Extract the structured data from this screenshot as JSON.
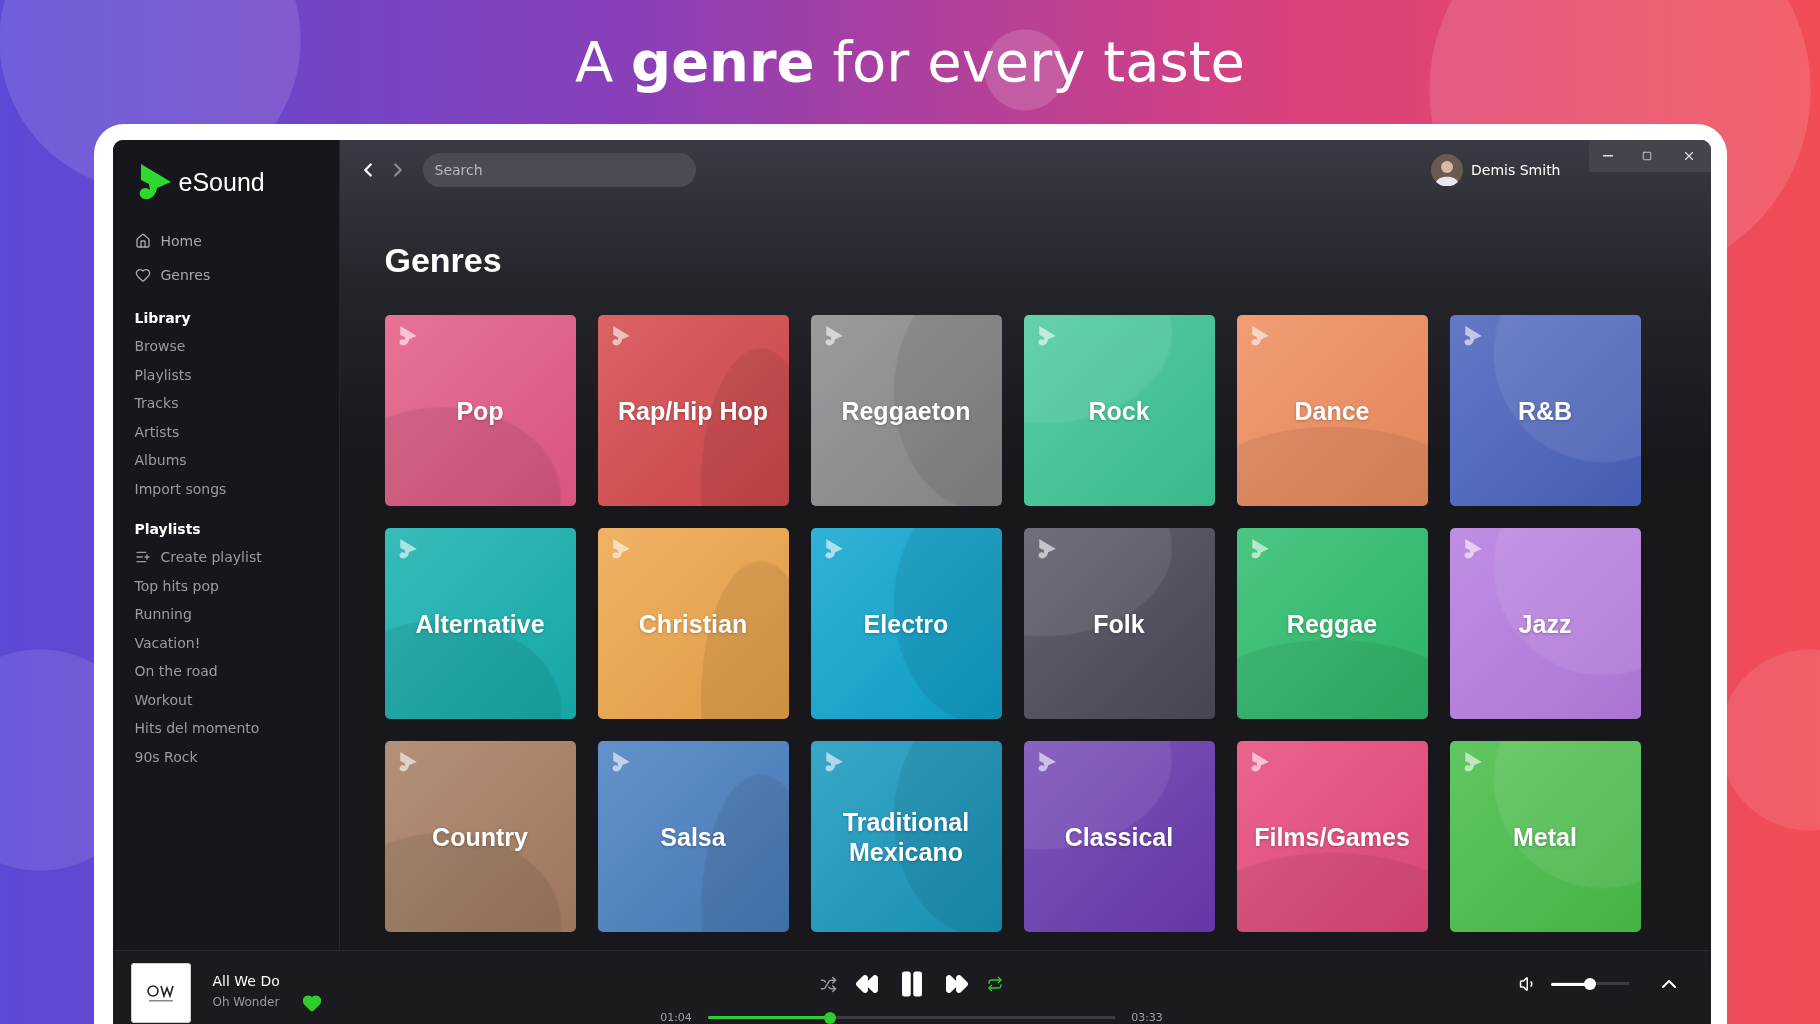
{
  "headline": "A **genre** for every taste",
  "app": {
    "logo": "eSound",
    "nav": [
      {
        "label": "Home",
        "kind": "home"
      },
      {
        "label": "Genres",
        "kind": "heart"
      }
    ],
    "sections": [
      {
        "title": "Library",
        "items": [
          {
            "label": "Browse",
            "kind": "link"
          },
          {
            "label": "Playlists",
            "kind": "link"
          },
          {
            "label": "Tracks",
            "kind": "link"
          },
          {
            "label": "Artists",
            "kind": "link"
          },
          {
            "label": "Albums",
            "kind": "link"
          },
          {
            "label": "Import songs",
            "kind": "link"
          }
        ]
      },
      {
        "title": "Playlists",
        "items": [
          {
            "label": "Create playlist",
            "kind": "action"
          },
          {
            "label": "Top hits pop",
            "kind": "link"
          },
          {
            "label": "Running",
            "kind": "link"
          },
          {
            "label": "Vacation!",
            "kind": "link"
          },
          {
            "label": "On the road",
            "kind": "link"
          },
          {
            "label": "Workout",
            "kind": "link"
          },
          {
            "label": "Hits del momento",
            "kind": "link"
          },
          {
            "label": "90s Rock",
            "kind": "link"
          }
        ]
      }
    ],
    "search": {
      "placeholder": "Search"
    },
    "user": {
      "name": "Demis Smith"
    },
    "page_title": "Genres",
    "genres": [
      {
        "label": "Pop",
        "color": "#e45b85"
      },
      {
        "label": "Rap/Hip Hop",
        "color": "#d4494c"
      },
      {
        "label": "Reggaeton",
        "color": "#8b8a8c"
      },
      {
        "label": "Rock",
        "color": "#3cc594"
      },
      {
        "label": "Dance",
        "color": "#ef8d5e"
      },
      {
        "label": "R&B",
        "color": "#4a62bd"
      },
      {
        "label": "Alternative",
        "color": "#17b0b0"
      },
      {
        "label": "Christian",
        "color": "#eda54a"
      },
      {
        "label": "Electro",
        "color": "#0ea5cf"
      },
      {
        "label": "Folk",
        "color": "#4a4a58"
      },
      {
        "label": "Reggae",
        "color": "#2dbd6e"
      },
      {
        "label": "Jazz",
        "color": "#b67be0"
      },
      {
        "label": "Country",
        "color": "#a67e62"
      },
      {
        "label": "Salsa",
        "color": "#4a7fc0"
      },
      {
        "label": "Traditional Mexicano",
        "color": "#1898be"
      },
      {
        "label": "Classical",
        "color": "#6a3ab0"
      },
      {
        "label": "Films/Games",
        "color": "#e64b7b"
      },
      {
        "label": "Metal",
        "color": "#48bd48"
      }
    ],
    "player": {
      "title": "All We Do",
      "artist": "Oh Wonder",
      "liked": true,
      "shuffle": false,
      "repeat": true,
      "elapsed": "01:04",
      "duration": "03:33",
      "progress": {
        "level": 0.3
      },
      "volume": {
        "level": 0.5
      }
    }
  }
}
